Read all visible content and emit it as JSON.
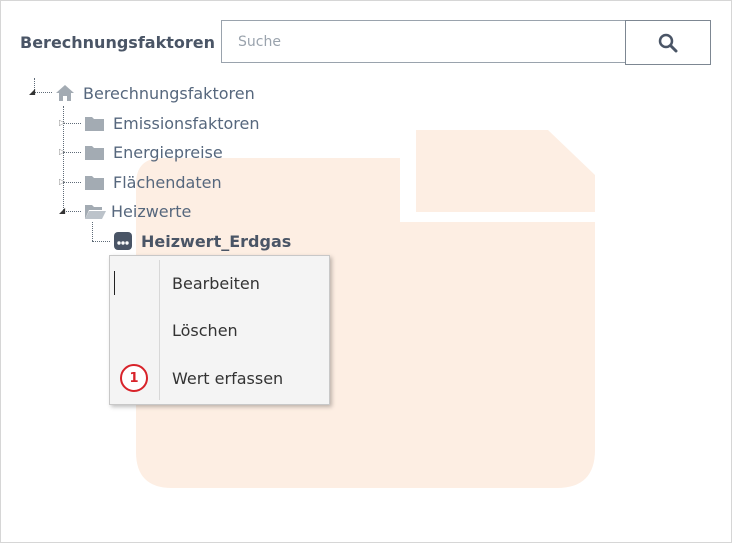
{
  "header": {
    "title": "Berechnungsfaktoren",
    "search_placeholder": "Suche",
    "search_value": ""
  },
  "tree": {
    "root": {
      "label": "Berechnungsfaktoren",
      "icon": "home-icon",
      "expanded": true
    },
    "children": [
      {
        "label": "Emissionsfaktoren",
        "icon": "folder-icon",
        "expanded": false
      },
      {
        "label": "Energiepreise",
        "icon": "folder-icon",
        "expanded": false
      },
      {
        "label": "Flächendaten",
        "icon": "folder-icon",
        "expanded": false
      },
      {
        "label": "Heizwerte",
        "icon": "folder-open-icon",
        "expanded": true,
        "children": [
          {
            "label": "Heizwert_Erdgas",
            "icon": "record-icon"
          }
        ]
      }
    ]
  },
  "context_menu": {
    "items": [
      {
        "label": "Bearbeiten"
      },
      {
        "label": "Löschen"
      },
      {
        "label": "Wert erfassen",
        "badge": "1"
      }
    ]
  },
  "colors": {
    "icon_gray": "#a3abb3",
    "text": "#56677d",
    "watermark": "#fdeee3",
    "badge": "#d8232a"
  }
}
